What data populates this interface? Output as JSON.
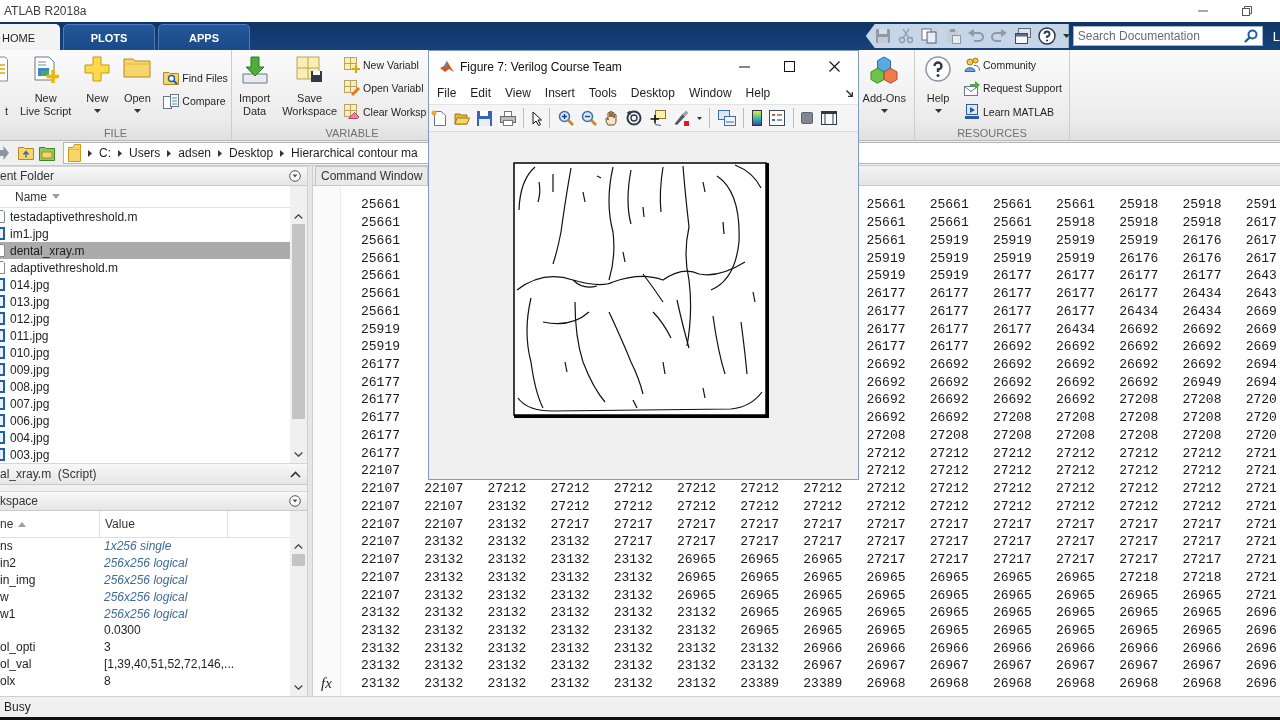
{
  "window": {
    "title": "ATLAB R2018a"
  },
  "tabs": [
    {
      "label": "HOME",
      "selected": true
    },
    {
      "label": "PLOTS",
      "selected": false
    },
    {
      "label": "APPS",
      "selected": false
    }
  ],
  "search": {
    "placeholder": "Search Documentation"
  },
  "header_link": "L",
  "toolstrip": [
    {
      "label": "FILE",
      "buttons": [
        {
          "lines": [
            "t"
          ],
          "menu": false
        },
        {
          "lines": [
            "New",
            "Live Script"
          ],
          "menu": false
        },
        {
          "lines": [
            "New"
          ],
          "menu": true
        },
        {
          "lines": [
            "Open"
          ],
          "menu": true
        }
      ],
      "small_buttons": [
        "Find Files",
        "Compare"
      ]
    },
    {
      "label": "VARIABLE",
      "buttons": [
        {
          "lines": [
            "Import",
            "Data"
          ],
          "menu": false
        },
        {
          "lines": [
            "Save",
            "Workspace"
          ],
          "menu": false
        }
      ],
      "small_buttons": [
        "New Variabl",
        "Open Variabl",
        "Clear Worksp"
      ]
    },
    {
      "buttons": [
        {
          "lines": [
            "Add-Ons"
          ],
          "menu": true
        }
      ]
    },
    {
      "label": "RESOURCES",
      "buttons": [
        {
          "lines": [
            "Help"
          ],
          "menu": true
        }
      ],
      "small_buttons": [
        "Community",
        "Request Support",
        "Learn MATLAB"
      ]
    }
  ],
  "path": [
    "C:",
    "Users",
    "adsen",
    "Desktop",
    "Hierarchical contour ma"
  ],
  "current_folder": {
    "title": "ent Folder",
    "column": "Name",
    "files": [
      {
        "name": "testadaptivethreshold.m",
        "kind": "script",
        "selected": false
      },
      {
        "name": "im1.jpg",
        "kind": "image",
        "selected": false
      },
      {
        "name": "dental_xray.m",
        "kind": "script",
        "selected": true
      },
      {
        "name": "adaptivethreshold.m",
        "kind": "script",
        "selected": false
      },
      {
        "name": "014.jpg",
        "kind": "image",
        "selected": false
      },
      {
        "name": "013.jpg",
        "kind": "image",
        "selected": false
      },
      {
        "name": "012.jpg",
        "kind": "image",
        "selected": false
      },
      {
        "name": "011.jpg",
        "kind": "image",
        "selected": false
      },
      {
        "name": "010.jpg",
        "kind": "image",
        "selected": false
      },
      {
        "name": "009.jpg",
        "kind": "image",
        "selected": false
      },
      {
        "name": "008.jpg",
        "kind": "image",
        "selected": false
      },
      {
        "name": "007.jpg",
        "kind": "image",
        "selected": false
      },
      {
        "name": "006.jpg",
        "kind": "image",
        "selected": false
      },
      {
        "name": "004.jpg",
        "kind": "image",
        "selected": false
      },
      {
        "name": "003.jpg",
        "kind": "image",
        "selected": false
      }
    ]
  },
  "details": {
    "title": "al_xray.m  (Script)"
  },
  "workspace": {
    "title": "kspace",
    "columns": [
      "ne",
      "Value"
    ],
    "rows": [
      {
        "name": "ns",
        "value": "1x256 single",
        "kind": "summary"
      },
      {
        "name": "in2",
        "value": "256x256 logical",
        "kind": "summary"
      },
      {
        "name": "in_img",
        "value": "256x256 logical",
        "kind": "summary"
      },
      {
        "name": "w",
        "value": "256x256 logical",
        "kind": "summary"
      },
      {
        "name": "w1",
        "value": "256x256 logical",
        "kind": "summary"
      },
      {
        "value": "0.0300",
        "kind": "value"
      },
      {
        "name": "ol_opti",
        "value": "3",
        "kind": "value"
      },
      {
        "name": "ol_val",
        "value": "[1,39,40,51,52,72,146,...",
        "kind": "value"
      },
      {
        "name": "olx",
        "value": "8",
        "kind": "value"
      }
    ]
  },
  "command_window": {
    "title": "Command Window",
    "prompt_button": "fx",
    "rows": [
      [
        "25661",
        null,
        null,
        null,
        null,
        null,
        null,
        null,
        "25661",
        "25661",
        "25661",
        "25661",
        "25918",
        "25918",
        "2591"
      ],
      [
        "25661",
        null,
        null,
        null,
        null,
        null,
        null,
        null,
        "25661",
        "25661",
        "25661",
        "25918",
        "25918",
        "25918",
        "2617"
      ],
      [
        "25661",
        null,
        null,
        null,
        null,
        null,
        null,
        null,
        "25661",
        "25919",
        "25919",
        "25919",
        "25919",
        "26176",
        "2617"
      ],
      [
        "25661",
        null,
        null,
        null,
        null,
        null,
        null,
        null,
        "25919",
        "25919",
        "25919",
        "25919",
        "26176",
        "26176",
        "2617"
      ],
      [
        "25661",
        null,
        null,
        null,
        null,
        null,
        null,
        null,
        "25919",
        "25919",
        "26177",
        "26177",
        "26177",
        "26177",
        "2643"
      ],
      [
        "25661",
        null,
        null,
        null,
        null,
        null,
        null,
        null,
        "26177",
        "26177",
        "26177",
        "26177",
        "26177",
        "26434",
        "2643"
      ],
      [
        "25661",
        null,
        null,
        null,
        null,
        null,
        null,
        null,
        "26177",
        "26177",
        "26177",
        "26177",
        "26434",
        "26434",
        "2669"
      ],
      [
        "25919",
        null,
        null,
        null,
        null,
        null,
        null,
        null,
        "26177",
        "26177",
        "26177",
        "26434",
        "26692",
        "26692",
        "2669"
      ],
      [
        "25919",
        null,
        null,
        null,
        null,
        null,
        null,
        null,
        "26177",
        "26177",
        "26692",
        "26692",
        "26692",
        "26692",
        "2669"
      ],
      [
        "26177",
        null,
        null,
        null,
        null,
        null,
        null,
        null,
        "26692",
        "26692",
        "26692",
        "26692",
        "26692",
        "26692",
        "2694"
      ],
      [
        "26177",
        null,
        null,
        null,
        null,
        null,
        null,
        null,
        "26692",
        "26692",
        "26692",
        "26692",
        "26692",
        "26949",
        "2694"
      ],
      [
        "26177",
        null,
        null,
        null,
        null,
        null,
        null,
        null,
        "26692",
        "26692",
        "26692",
        "26692",
        "27208",
        "27208",
        "2720"
      ],
      [
        "26177",
        null,
        null,
        null,
        null,
        null,
        null,
        null,
        "26692",
        "26692",
        "27208",
        "27208",
        "27208",
        "27208",
        "2720"
      ],
      [
        "26177",
        null,
        null,
        null,
        null,
        null,
        null,
        null,
        "27208",
        "27208",
        "27208",
        "27208",
        "27208",
        "27208",
        "2720"
      ],
      [
        "26177",
        null,
        null,
        null,
        null,
        null,
        null,
        null,
        "27212",
        "27212",
        "27212",
        "27212",
        "27212",
        "27212",
        "2721"
      ],
      [
        "22107",
        null,
        null,
        null,
        null,
        null,
        null,
        null,
        "27212",
        "27212",
        "27212",
        "27212",
        "27212",
        "27212",
        "2721"
      ],
      [
        "22107",
        "22107",
        "27212",
        "27212",
        "27212",
        "27212",
        "27212",
        "27212",
        "27212",
        "27212",
        "27212",
        "27212",
        "27212",
        "27212",
        "2721"
      ],
      [
        "22107",
        "22107",
        "23132",
        "27212",
        "27212",
        "27212",
        "27212",
        "27212",
        "27212",
        "27212",
        "27212",
        "27212",
        "27212",
        "27212",
        "2721"
      ],
      [
        "22107",
        "22107",
        "23132",
        "27217",
        "27217",
        "27217",
        "27217",
        "27217",
        "27217",
        "27217",
        "27217",
        "27217",
        "27217",
        "27217",
        "2721"
      ],
      [
        "22107",
        "23132",
        "23132",
        "23132",
        "27217",
        "27217",
        "27217",
        "27217",
        "27217",
        "27217",
        "27217",
        "27217",
        "27217",
        "27217",
        "2721"
      ],
      [
        "22107",
        "23132",
        "23132",
        "23132",
        "23132",
        "26965",
        "26965",
        "26965",
        "27217",
        "27217",
        "27217",
        "27217",
        "27217",
        "27217",
        "2721"
      ],
      [
        "22107",
        "23132",
        "23132",
        "23132",
        "23132",
        "26965",
        "26965",
        "26965",
        "26965",
        "26965",
        "26965",
        "26965",
        "27218",
        "27218",
        "2721"
      ],
      [
        "22107",
        "23132",
        "23132",
        "23132",
        "23132",
        "26965",
        "26965",
        "26965",
        "26965",
        "26965",
        "26965",
        "26965",
        "26965",
        "26965",
        "2721"
      ],
      [
        "23132",
        "23132",
        "23132",
        "23132",
        "23132",
        "23132",
        "26965",
        "26965",
        "26965",
        "26965",
        "26965",
        "26965",
        "26965",
        "26965",
        "2696"
      ],
      [
        "23132",
        "23132",
        "23132",
        "23132",
        "23132",
        "23132",
        "26965",
        "26965",
        "26965",
        "26965",
        "26965",
        "26965",
        "26965",
        "26965",
        "2696"
      ],
      [
        "23132",
        "23132",
        "23132",
        "23132",
        "23132",
        "23132",
        "23132",
        "26966",
        "26966",
        "26966",
        "26966",
        "26966",
        "26966",
        "26966",
        "2696"
      ],
      [
        "23132",
        "23132",
        "23132",
        "23132",
        "23132",
        "23132",
        "23132",
        "26967",
        "26967",
        "26967",
        "26967",
        "26967",
        "26967",
        "26967",
        "2696"
      ],
      [
        "23132",
        "23132",
        "23132",
        "23132",
        "23132",
        "23132",
        "23389",
        "23389",
        "26968",
        "26968",
        "26968",
        "26968",
        "26968",
        "26968",
        "2696"
      ]
    ]
  },
  "figure": {
    "title": "Figure 7: Verilog Course Team",
    "menu": [
      "File",
      "Edit",
      "View",
      "Insert",
      "Tools",
      "Desktop",
      "Window",
      "Help"
    ]
  },
  "status_bar": {
    "text": "Busy"
  }
}
